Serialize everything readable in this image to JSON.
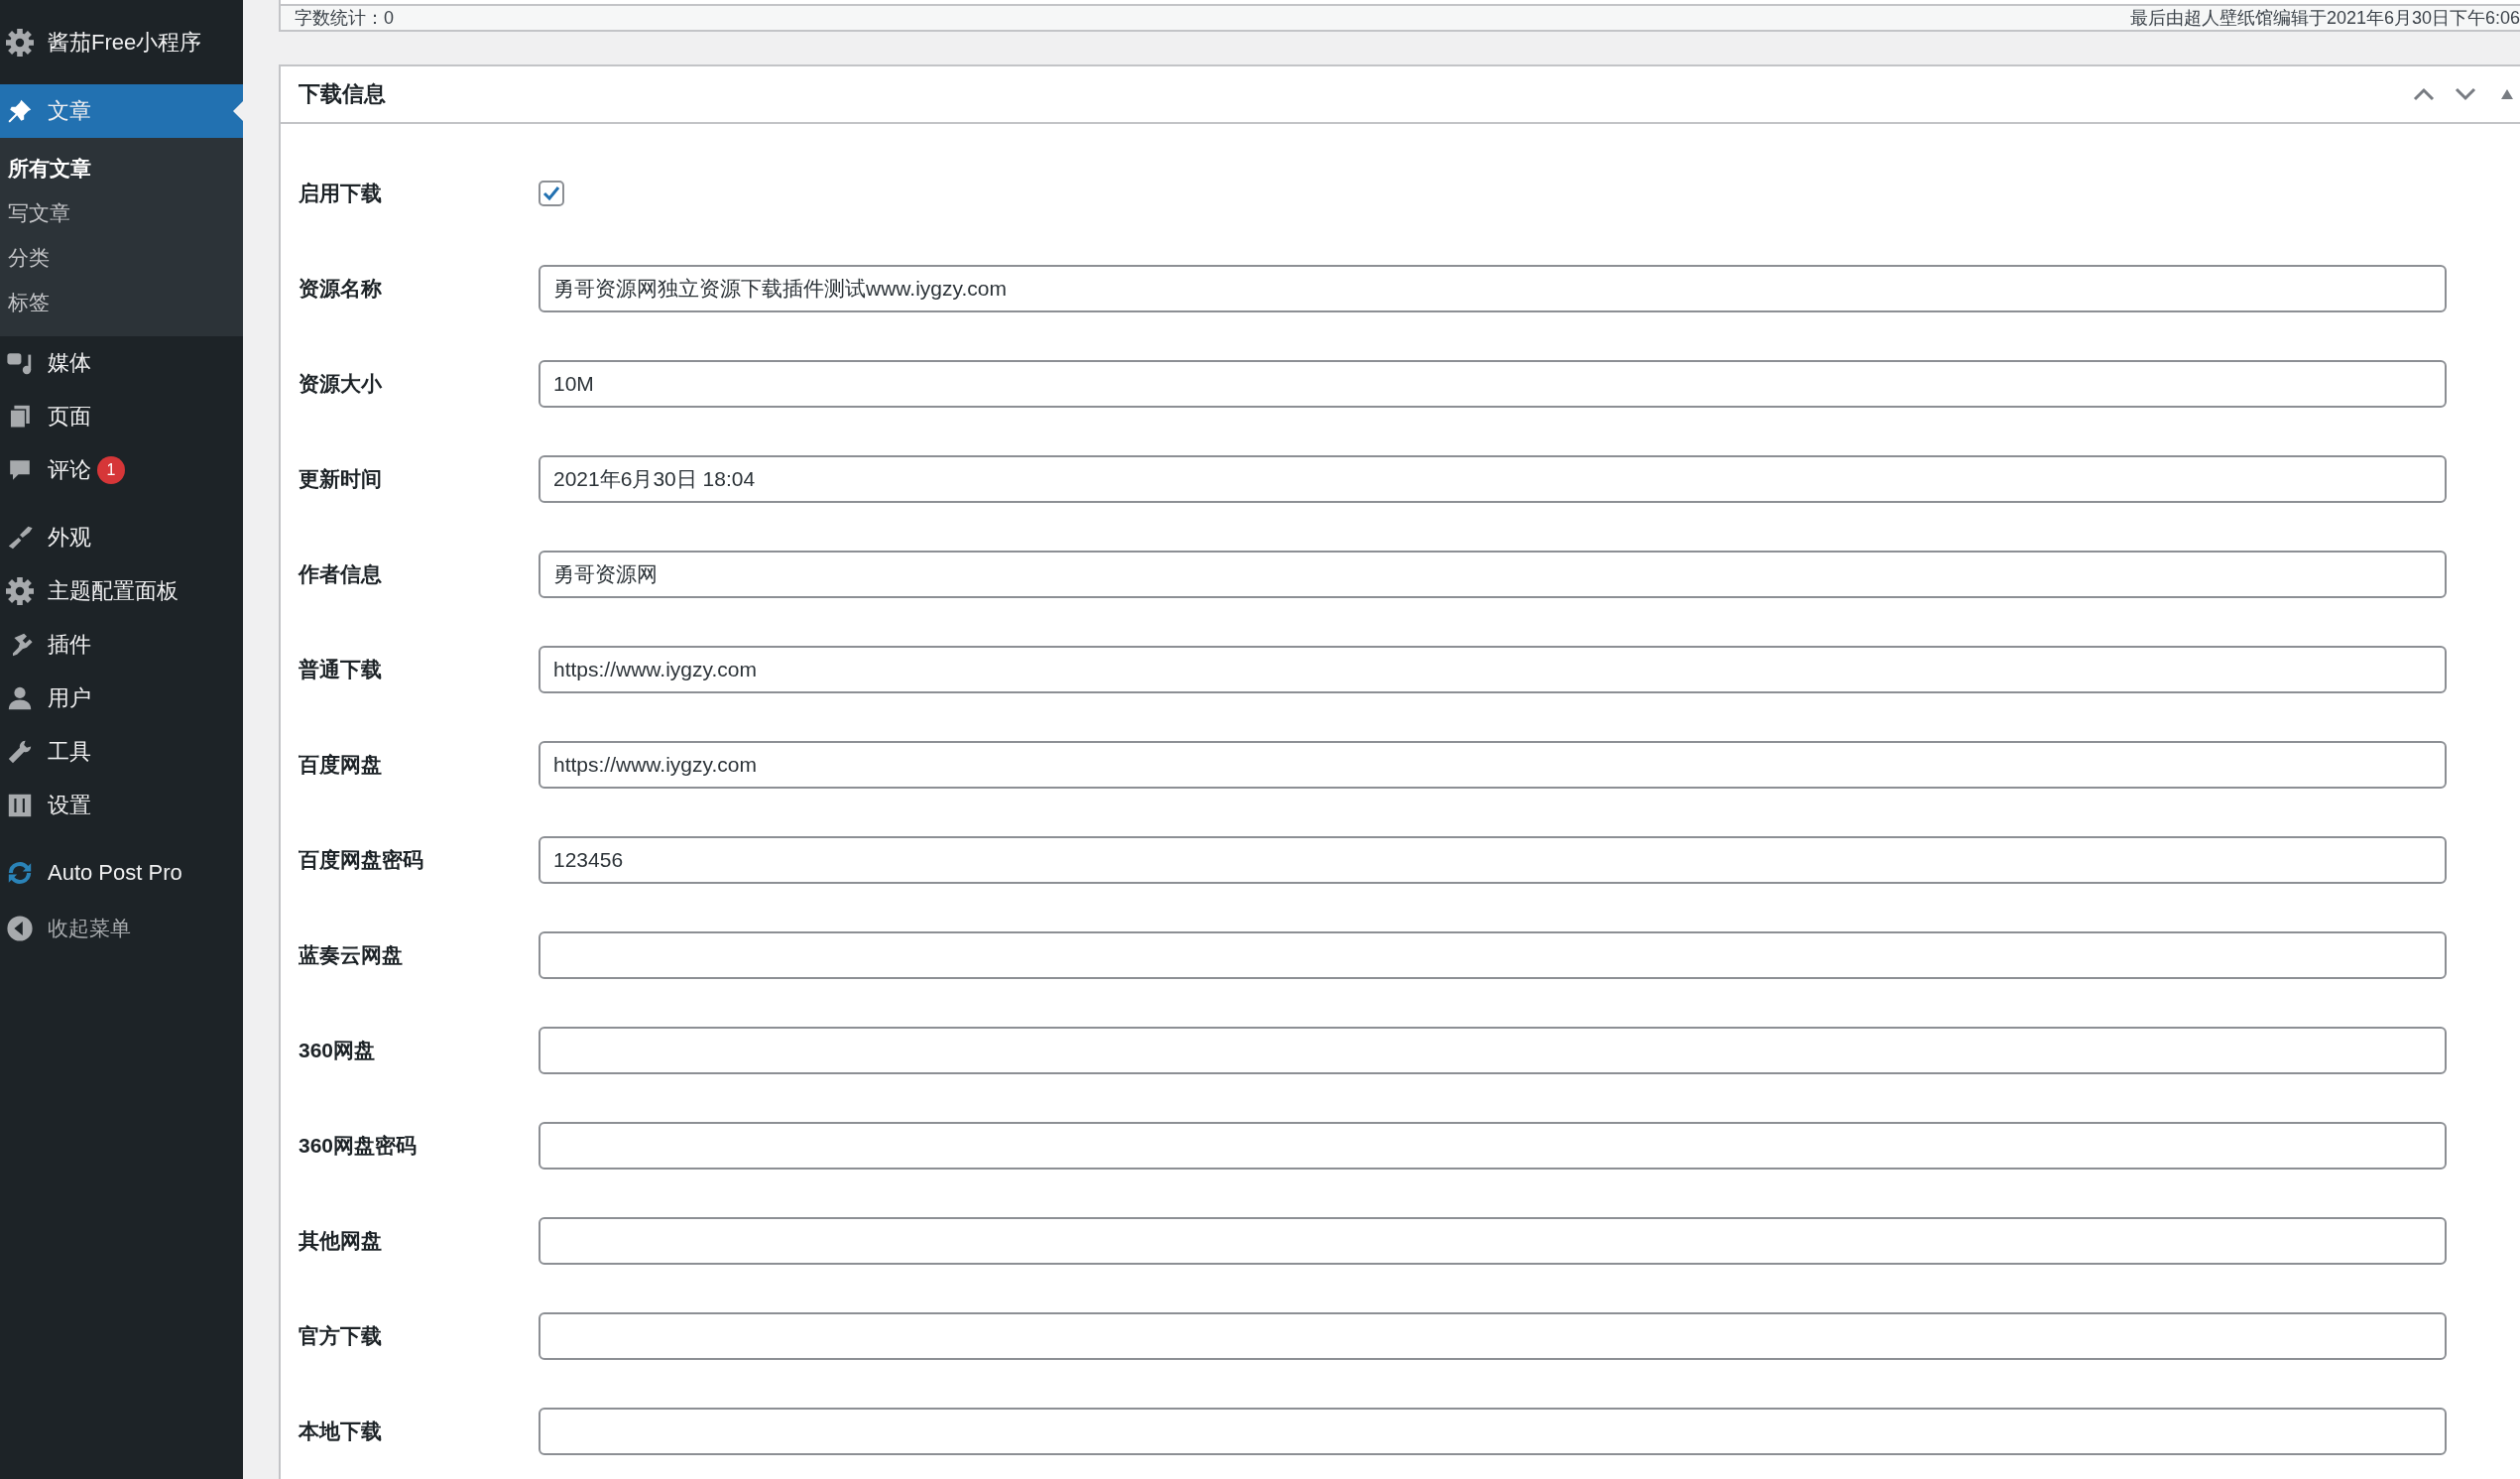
{
  "sidebar": {
    "site": {
      "label": "酱茄Free小程序"
    },
    "items": [
      {
        "label": "文章",
        "selected": true,
        "children": [
          {
            "label": "所有文章",
            "selected": true
          },
          {
            "label": "写文章",
            "selected": false
          },
          {
            "label": "分类",
            "selected": false
          },
          {
            "label": "标签",
            "selected": false
          }
        ]
      },
      {
        "label": "媒体",
        "selected": false
      },
      {
        "label": "页面",
        "selected": false
      },
      {
        "label": "评论",
        "selected": false,
        "badge": "1"
      },
      {
        "label": "外观",
        "selected": false
      },
      {
        "label": "主题配置面板",
        "selected": false
      },
      {
        "label": "插件",
        "selected": false
      },
      {
        "label": "用户",
        "selected": false
      },
      {
        "label": "工具",
        "selected": false
      },
      {
        "label": "设置",
        "selected": false
      },
      {
        "label": "Auto Post Pro",
        "selected": false
      }
    ],
    "collapse": {
      "label": "收起菜单"
    }
  },
  "editor_status": {
    "word_count": "字数统计：0",
    "last_edited": "最后由超人壁纸馆编辑于2021年6月30日下午6:06"
  },
  "panel": {
    "title": "下载信息",
    "fields": [
      {
        "kind": "checkbox",
        "label": "启用下载",
        "checked": true
      },
      {
        "kind": "text",
        "label": "资源名称",
        "value": "勇哥资源网独立资源下载插件测试www.iygzy.com"
      },
      {
        "kind": "text",
        "label": "资源大小",
        "value": "10M"
      },
      {
        "kind": "text",
        "label": "更新时间",
        "value": "2021年6月30日 18:04"
      },
      {
        "kind": "text",
        "label": "作者信息",
        "value": "勇哥资源网"
      },
      {
        "kind": "text",
        "label": "普通下载",
        "value": "https://www.iygzy.com"
      },
      {
        "kind": "text",
        "label": "百度网盘",
        "value": "https://www.iygzy.com"
      },
      {
        "kind": "text",
        "label": "百度网盘密码",
        "value": "123456"
      },
      {
        "kind": "text",
        "label": "蓝奏云网盘"
      },
      {
        "kind": "text",
        "label": "360网盘"
      },
      {
        "kind": "text",
        "label": "360网盘密码"
      },
      {
        "kind": "text",
        "label": "其他网盘"
      },
      {
        "kind": "text",
        "label": "官方下载"
      },
      {
        "kind": "text",
        "label": "本地下载"
      }
    ]
  }
}
